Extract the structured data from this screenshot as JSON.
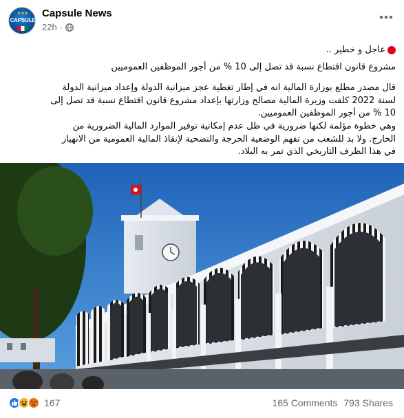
{
  "post": {
    "page_name": "Capsule News",
    "time": "22h",
    "separator": "·",
    "privacy_icon": "globe-icon",
    "avatar": {
      "text": "CAPSULE",
      "stars": "★★★"
    },
    "text": {
      "urgent": "عاجل و خطير ..",
      "headline": "مشروع قانون اقتطاع نسبة قد تصل إلى 10 % من أجور الموظفين  العموميين",
      "paragraph_lines": [
        "قال مصدر مطلع  بوزارة المالية انه في إطار تغطية عجز ميزانية الدولة وإعداد ميزانية الدولة",
        "لسنة 2022 كلفت وزيرة المالية مصالح وزارتها بإعداد مشروع قانون اقتطاع نسبة قد تصل إلى",
        "10 % من أجور الموظفين  العموميين.",
        "وهي خطوة مؤلمة لكنها ضرورية في ظل عدم إمكانية توفير الموارد المالية الضرورية من",
        "الخارج.  ولا بد للشعب من تفهم الوضعية الحرجة والتضحية لإنقاذ المالية العمومية من الانهيار",
        "في هذا الظرف التاريخي الذي تمر به البلاد."
      ]
    },
    "photo": {
      "subject": "white colonial government building with black-and-white striped arches and clock tower, Tunisian flag"
    },
    "footer": {
      "reaction_icons": [
        "like-icon",
        "haha-icon",
        "angry-icon"
      ],
      "reaction_count": "167",
      "comments": "165 Comments",
      "shares": "793 Shares"
    }
  },
  "colors": {
    "like_blue": "#1877f2",
    "haha_yellow": "#f7b125",
    "angry_orange": "#e9710f",
    "secondary_text": "#65676b",
    "urgent_red": "#e0001b",
    "sky": "#2f78c9"
  }
}
